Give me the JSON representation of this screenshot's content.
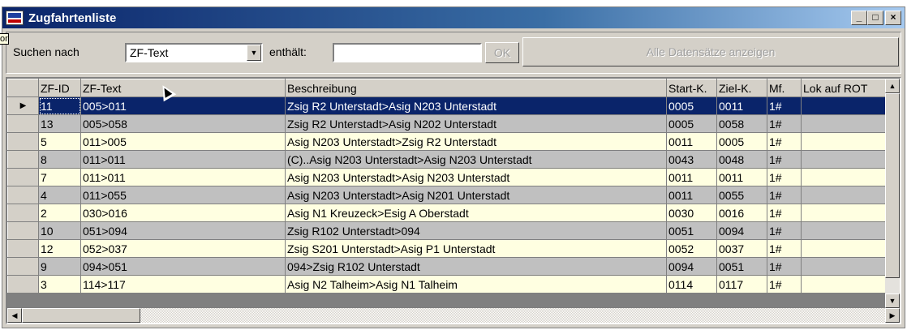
{
  "window": {
    "title": "Zugfahrtenliste",
    "controls": {
      "minimize": "_",
      "maximize": "□",
      "close": "×"
    }
  },
  "toolbar": {
    "search_label": "Suchen nach",
    "field_value": "ZF-Text",
    "contains_label": "enthält:",
    "search_value": "",
    "ok_label": "OK",
    "show_all_label": "Alle Datensätze anzeigen",
    "edge_tip": "or"
  },
  "table": {
    "columns": [
      "ZF-ID",
      "ZF-Text",
      "Beschreibung",
      "Start-K.",
      "Ziel-K.",
      "Mf.",
      "Lok auf ROT"
    ],
    "rows": [
      [
        "11",
        "005>011",
        "Zsig R2 Unterstadt>Asig N203 Unterstadt",
        "0005",
        "0011",
        "1#",
        ""
      ],
      [
        "13",
        "005>058",
        "Zsig R2 Unterstadt>Asig N202 Unterstadt",
        "0005",
        "0058",
        "1#",
        ""
      ],
      [
        "5",
        "011>005",
        "Asig N203 Unterstadt>Zsig R2 Unterstadt",
        "0011",
        "0005",
        "1#",
        ""
      ],
      [
        "8",
        "011>011",
        "(C)..Asig N203 Unterstadt>Asig N203 Unterstadt",
        "0043",
        "0048",
        "1#",
        ""
      ],
      [
        "7",
        "011>011",
        "Asig N203 Unterstadt>Asig N203 Unterstadt",
        "0011",
        "0011",
        "1#",
        ""
      ],
      [
        "4",
        "011>055",
        "Asig N203 Unterstadt>Asig N201 Unterstadt",
        "0011",
        "0055",
        "1#",
        ""
      ],
      [
        "2",
        "030>016",
        "Asig N1 Kreuzeck>Esig A Oberstadt",
        "0030",
        "0016",
        "1#",
        ""
      ],
      [
        "10",
        "051>094",
        "Zsig R102 Unterstadt>094",
        "0051",
        "0094",
        "1#",
        ""
      ],
      [
        "12",
        "052>037",
        "Zsig S201 Unterstadt>Asig P1 Unterstadt",
        "0052",
        "0037",
        "1#",
        ""
      ],
      [
        "9",
        "094>051",
        "094>Zsig R102 Unterstadt",
        "0094",
        "0051",
        "1#",
        ""
      ],
      [
        "3",
        "114>117",
        "Asig N2 Talheim>Asig N1 Talheim",
        "0114",
        "0117",
        "1#",
        ""
      ]
    ],
    "selected_row": 0,
    "row_indicator": "▶"
  },
  "scroll": {
    "up": "▲",
    "down": "▼",
    "left": "◀",
    "right": "▶"
  },
  "colors": {
    "title_start": "#0a246a",
    "title_end": "#a6caf0",
    "row_light": "#ffffe1",
    "row_dark": "#c0c0c0",
    "selection": "#0a246a"
  },
  "icons": {
    "app": "wdp-app-icon",
    "combo": "dropdown-arrow-icon",
    "cursor": "mouse-pointer-icon"
  }
}
